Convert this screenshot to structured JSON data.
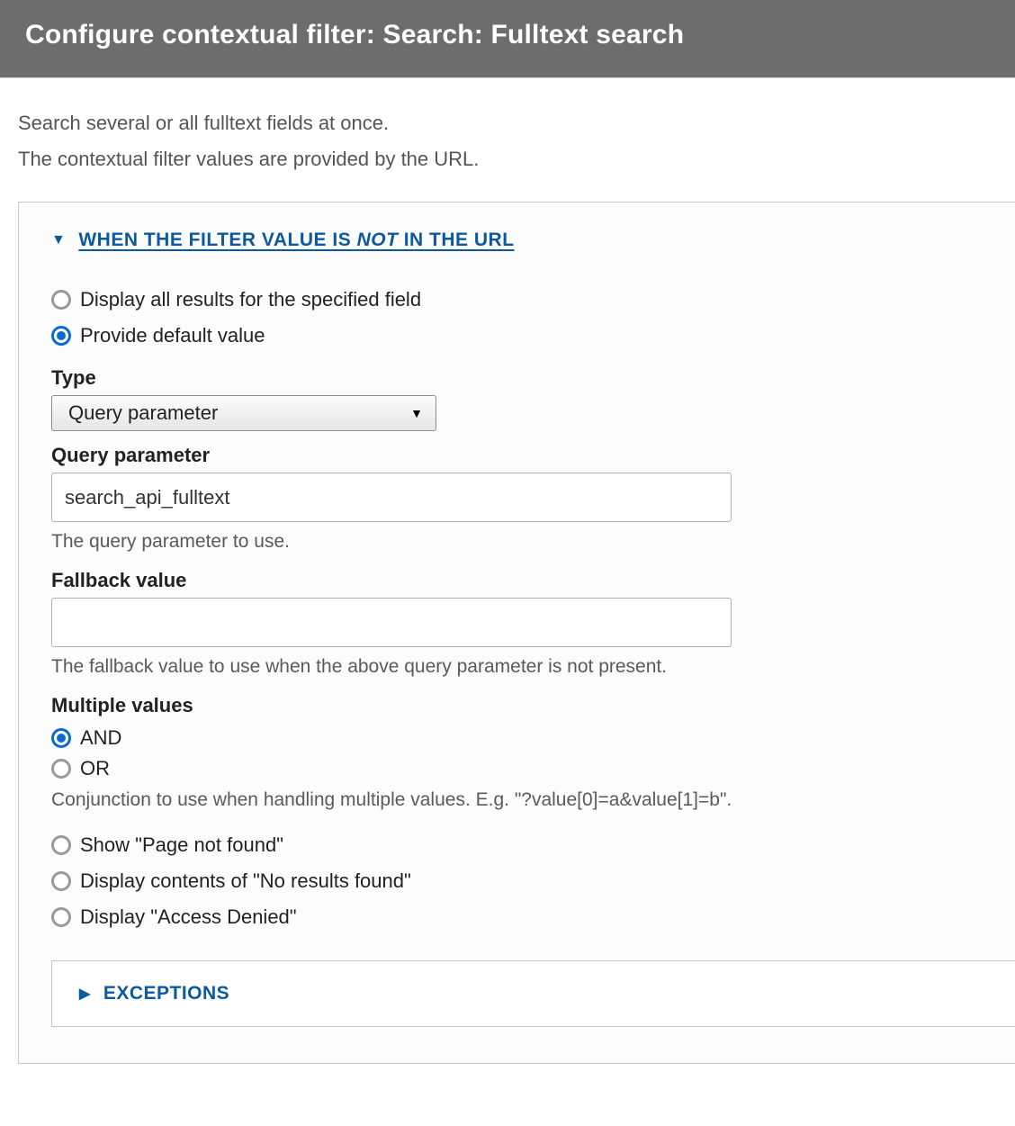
{
  "header": {
    "title": "Configure contextual filter: Search: Fulltext search"
  },
  "intro": {
    "line1": "Search several or all fulltext fields at once.",
    "line2": "The contextual filter values are provided by the URL."
  },
  "section": {
    "title_prefix": "WHEN THE FILTER VALUE IS ",
    "title_em": "NOT",
    "title_suffix": " IN THE URL",
    "options": {
      "display_all": "Display all results for the specified field",
      "provide_default": "Provide default value",
      "show_404": "Show \"Page not found\"",
      "no_results": "Display contents of \"No results found\"",
      "access_denied": "Display \"Access Denied\""
    },
    "type": {
      "label": "Type",
      "selected": "Query parameter"
    },
    "query_param": {
      "label": "Query parameter",
      "value": "search_api_fulltext",
      "help": "The query parameter to use."
    },
    "fallback": {
      "label": "Fallback value",
      "value": "",
      "help": "The fallback value to use when the above query parameter is not present."
    },
    "multiple": {
      "label": "Multiple values",
      "and": "AND",
      "or": "OR",
      "help": "Conjunction to use when handling multiple values. E.g. \"?value[0]=a&value[1]=b\"."
    },
    "exceptions": {
      "title": "EXCEPTIONS"
    }
  }
}
